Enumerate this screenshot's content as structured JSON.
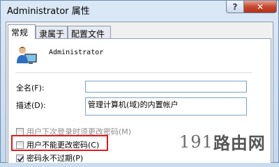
{
  "window": {
    "title": "Administrator 属性",
    "help_label": "?",
    "close_label": "✕"
  },
  "tabs": [
    {
      "label": "常规",
      "active": true
    },
    {
      "label": "隶属于",
      "active": false
    },
    {
      "label": "配置文件",
      "active": false
    }
  ],
  "general": {
    "username": "Administrator",
    "user_icon": "user-icon",
    "full_name_label": "全名(F):",
    "full_name_value": "",
    "description_label": "描述(D):",
    "description_value": "管理计算机(域)的内置帐户"
  },
  "checkboxes": [
    {
      "label": "用户下次登录时须更改密码(M)",
      "checked": false,
      "disabled": true
    },
    {
      "label": "用户不能更改密码(C)",
      "checked": false,
      "disabled": false
    },
    {
      "label": "密码永不过期(P)",
      "checked": true,
      "disabled": false
    }
  ],
  "watermark": {
    "number": "191",
    "text": "路由网"
  },
  "colors": {
    "highlight": "#e0191b",
    "close_button": "#c74a32",
    "textbox_border": "#7aa3c8"
  }
}
